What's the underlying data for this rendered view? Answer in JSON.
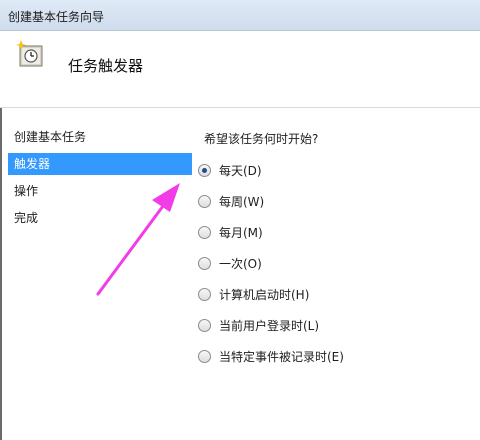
{
  "window": {
    "title": "创建基本任务向导"
  },
  "header": {
    "title": "任务触发器",
    "icon": "scheduled-task-clock-icon"
  },
  "nav": {
    "items": [
      {
        "label": "创建基本任务",
        "selected": false
      },
      {
        "label": "触发器",
        "selected": true
      },
      {
        "label": "操作",
        "selected": false
      },
      {
        "label": "完成",
        "selected": false
      }
    ]
  },
  "main": {
    "question": "希望该任务何时开始?",
    "options": [
      {
        "label": "每天(D)",
        "checked": true
      },
      {
        "label": "每周(W)",
        "checked": false
      },
      {
        "label": "每月(M)",
        "checked": false
      },
      {
        "label": "一次(O)",
        "checked": false
      },
      {
        "label": "计算机启动时(H)",
        "checked": false
      },
      {
        "label": "当前用户登录时(L)",
        "checked": false
      },
      {
        "label": "当特定事件被记录时(E)",
        "checked": false
      }
    ]
  },
  "annotation": {
    "color": "#f23ce8"
  },
  "colors": {
    "selection": "#3399ff"
  }
}
